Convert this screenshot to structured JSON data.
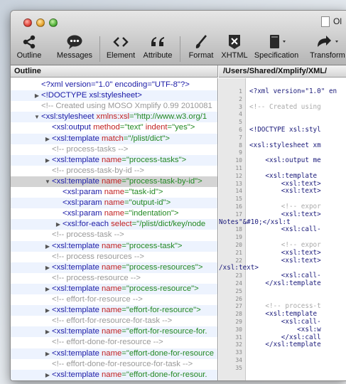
{
  "window": {
    "title": "Ol"
  },
  "toolbar": {
    "outline": "Outline",
    "messages": "Messages",
    "element": "Element",
    "attribute": "Attribute",
    "format": "Format",
    "xhtml": "XHTML",
    "specification": "Specification",
    "transform": "Transform"
  },
  "outline_pane": {
    "header": "Outline",
    "rows": [
      {
        "indent": 0,
        "expand": "",
        "el": "<?xml  version=\"1.0\" encoding=\"UTF-8\"?>",
        "kind": "pi"
      },
      {
        "indent": 0,
        "expand": "right",
        "el": "<!DOCTYPE xsl:stylesheet>",
        "kind": "el"
      },
      {
        "indent": 0,
        "expand": "",
        "el": "<!-- Created using MOSO Xmplify 0.99 2010081",
        "kind": "com"
      },
      {
        "indent": 0,
        "expand": "down",
        "el": "<xsl:stylesheet",
        "attr": "xmlns:xsl",
        "val": "=\"http://www.w3.org/1",
        "kind": "el"
      },
      {
        "indent": 1,
        "expand": "",
        "el": "<xsl:output",
        "attr": "method",
        "val": "=\"text\"",
        "attr2": "indent",
        "val2": "=\"yes\">",
        "kind": "el"
      },
      {
        "indent": 1,
        "expand": "right",
        "el": "<xsl:template",
        "attr": "match",
        "val": "=\"/plist/dict\">",
        "kind": "el"
      },
      {
        "indent": 1,
        "expand": "",
        "el": "<!-- process-tasks -->",
        "kind": "com"
      },
      {
        "indent": 1,
        "expand": "right",
        "el": "<xsl:template",
        "attr": "name",
        "val": "=\"process-tasks\">",
        "kind": "el"
      },
      {
        "indent": 1,
        "expand": "",
        "el": "<!-- process-task-by-id -->",
        "kind": "com"
      },
      {
        "indent": 1,
        "expand": "down",
        "el": "<xsl:template",
        "attr": "name",
        "val": "=\"process-task-by-id\">",
        "kind": "el",
        "selected": true
      },
      {
        "indent": 2,
        "expand": "",
        "el": "<xsl:param",
        "attr": "name",
        "val": "=\"task-id\">",
        "kind": "el"
      },
      {
        "indent": 2,
        "expand": "",
        "el": "<xsl:param",
        "attr": "name",
        "val": "=\"output-id\">",
        "kind": "el"
      },
      {
        "indent": 2,
        "expand": "",
        "el": "<xsl:param",
        "attr": "name",
        "val": "=\"indentation\">",
        "kind": "el"
      },
      {
        "indent": 2,
        "expand": "right",
        "el": "<xsl:for-each",
        "attr": "select",
        "val": "=\"/plist/dict/key/node",
        "kind": "el"
      },
      {
        "indent": 1,
        "expand": "",
        "el": "<!-- process-task -->",
        "kind": "com"
      },
      {
        "indent": 1,
        "expand": "right",
        "el": "<xsl:template",
        "attr": "name",
        "val": "=\"process-task\">",
        "kind": "el"
      },
      {
        "indent": 1,
        "expand": "",
        "el": "<!-- process resources -->",
        "kind": "com"
      },
      {
        "indent": 1,
        "expand": "right",
        "el": "<xsl:template",
        "attr": "name",
        "val": "=\"process-resources\">",
        "kind": "el"
      },
      {
        "indent": 1,
        "expand": "",
        "el": "<!-- process-resource -->",
        "kind": "com"
      },
      {
        "indent": 1,
        "expand": "right",
        "el": "<xsl:template",
        "attr": "name",
        "val": "=\"process-resource\">",
        "kind": "el"
      },
      {
        "indent": 1,
        "expand": "",
        "el": "<!-- effort-for-resource -->",
        "kind": "com"
      },
      {
        "indent": 1,
        "expand": "right",
        "el": "<xsl:template",
        "attr": "name",
        "val": "=\"effort-for-resource\">",
        "kind": "el"
      },
      {
        "indent": 1,
        "expand": "",
        "el": "<!-- effort-for-resource-for-task -->",
        "kind": "com"
      },
      {
        "indent": 1,
        "expand": "right",
        "el": "<xsl:template",
        "attr": "name",
        "val": "=\"effort-for-resource-for.",
        "kind": "el"
      },
      {
        "indent": 1,
        "expand": "",
        "el": "<!-- effort-done-for-resource -->",
        "kind": "com"
      },
      {
        "indent": 1,
        "expand": "right",
        "el": "<xsl:template",
        "attr": "name",
        "val": "=\"effort-done-for-resource",
        "kind": "el"
      },
      {
        "indent": 1,
        "expand": "",
        "el": "<!-- effort-done-for-resource-for-task -->",
        "kind": "com"
      },
      {
        "indent": 1,
        "expand": "right",
        "el": "<xsl:template",
        "attr": "name",
        "val": "=\"effort-done-for-resour.",
        "kind": "el"
      }
    ]
  },
  "editor": {
    "path": "/Users/Shared/Xmplify/XML/",
    "lines": [
      {
        "n": "1",
        "t": "<?xml version=\"1.0\" en",
        "kind": "code"
      },
      {
        "n": "2",
        "t": "",
        "kind": "code"
      },
      {
        "n": "3",
        "t": "<!-- Created using",
        "kind": "com"
      },
      {
        "n": "4",
        "t": "",
        "kind": "code"
      },
      {
        "n": "5",
        "t": "",
        "kind": "code"
      },
      {
        "n": "6",
        "t": "<!DOCTYPE xsl:styl",
        "kind": "code"
      },
      {
        "n": "7",
        "t": "",
        "kind": "code"
      },
      {
        "n": "8",
        "t": "<xsl:stylesheet xm",
        "kind": "code"
      },
      {
        "n": "9",
        "t": "",
        "kind": "code"
      },
      {
        "n": "10",
        "t": "    <xsl:output me",
        "kind": "code"
      },
      {
        "n": "11",
        "t": "",
        "kind": "code"
      },
      {
        "n": "12",
        "t": "    <xsl:template",
        "kind": "code"
      },
      {
        "n": "13",
        "t": "        <xsl:text>",
        "kind": "code"
      },
      {
        "n": "14",
        "t": "        <xsl:text>",
        "kind": "code"
      },
      {
        "n": "15",
        "t": "",
        "kind": "code"
      },
      {
        "n": "16",
        "t": "        <!-- expor",
        "kind": "com"
      },
      {
        "n": "17",
        "t": "        <xsl:text>",
        "kind": "code"
      },
      {
        "n": "",
        "t": "Notes\"&#10;</xsl:t",
        "kind": "code"
      },
      {
        "n": "18",
        "t": "        <xsl:call-",
        "kind": "code"
      },
      {
        "n": "19",
        "t": "",
        "kind": "code"
      },
      {
        "n": "20",
        "t": "        <!-- expor",
        "kind": "com"
      },
      {
        "n": "21",
        "t": "        <xsl:text>",
        "kind": "code"
      },
      {
        "n": "22",
        "t": "        <xsl:text>",
        "kind": "code"
      },
      {
        "n": "",
        "t": "/xsl:text>",
        "kind": "code"
      },
      {
        "n": "23",
        "t": "        <xsl:call-",
        "kind": "code"
      },
      {
        "n": "24",
        "t": "    </xsl:template",
        "kind": "code"
      },
      {
        "n": "25",
        "t": "",
        "kind": "code"
      },
      {
        "n": "26",
        "t": "",
        "kind": "code"
      },
      {
        "n": "27",
        "t": "    <!-- process-t",
        "kind": "com"
      },
      {
        "n": "28",
        "t": "    <xsl:template",
        "kind": "code"
      },
      {
        "n": "29",
        "t": "        <xsl:call-",
        "kind": "code"
      },
      {
        "n": "30",
        "t": "            <xsl:w",
        "kind": "code"
      },
      {
        "n": "31",
        "t": "        </xsl:call",
        "kind": "code"
      },
      {
        "n": "32",
        "t": "    </xsl:template",
        "kind": "code"
      },
      {
        "n": "33",
        "t": "",
        "kind": "code"
      },
      {
        "n": "34",
        "t": "",
        "kind": "code"
      },
      {
        "n": "35",
        "t": "",
        "kind": "code"
      }
    ]
  }
}
